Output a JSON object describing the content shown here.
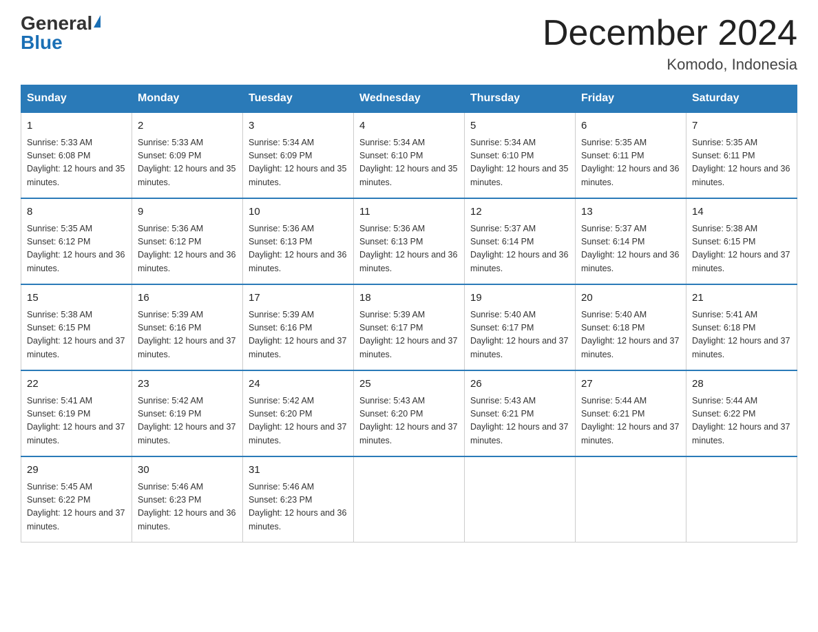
{
  "logo": {
    "general": "General",
    "blue": "Blue"
  },
  "title": "December 2024",
  "location": "Komodo, Indonesia",
  "days_of_week": [
    "Sunday",
    "Monday",
    "Tuesday",
    "Wednesday",
    "Thursday",
    "Friday",
    "Saturday"
  ],
  "weeks": [
    [
      {
        "day": "1",
        "sunrise": "5:33 AM",
        "sunset": "6:08 PM",
        "daylight": "12 hours and 35 minutes."
      },
      {
        "day": "2",
        "sunrise": "5:33 AM",
        "sunset": "6:09 PM",
        "daylight": "12 hours and 35 minutes."
      },
      {
        "day": "3",
        "sunrise": "5:34 AM",
        "sunset": "6:09 PM",
        "daylight": "12 hours and 35 minutes."
      },
      {
        "day": "4",
        "sunrise": "5:34 AM",
        "sunset": "6:10 PM",
        "daylight": "12 hours and 35 minutes."
      },
      {
        "day": "5",
        "sunrise": "5:34 AM",
        "sunset": "6:10 PM",
        "daylight": "12 hours and 35 minutes."
      },
      {
        "day": "6",
        "sunrise": "5:35 AM",
        "sunset": "6:11 PM",
        "daylight": "12 hours and 36 minutes."
      },
      {
        "day": "7",
        "sunrise": "5:35 AM",
        "sunset": "6:11 PM",
        "daylight": "12 hours and 36 minutes."
      }
    ],
    [
      {
        "day": "8",
        "sunrise": "5:35 AM",
        "sunset": "6:12 PM",
        "daylight": "12 hours and 36 minutes."
      },
      {
        "day": "9",
        "sunrise": "5:36 AM",
        "sunset": "6:12 PM",
        "daylight": "12 hours and 36 minutes."
      },
      {
        "day": "10",
        "sunrise": "5:36 AM",
        "sunset": "6:13 PM",
        "daylight": "12 hours and 36 minutes."
      },
      {
        "day": "11",
        "sunrise": "5:36 AM",
        "sunset": "6:13 PM",
        "daylight": "12 hours and 36 minutes."
      },
      {
        "day": "12",
        "sunrise": "5:37 AM",
        "sunset": "6:14 PM",
        "daylight": "12 hours and 36 minutes."
      },
      {
        "day": "13",
        "sunrise": "5:37 AM",
        "sunset": "6:14 PM",
        "daylight": "12 hours and 36 minutes."
      },
      {
        "day": "14",
        "sunrise": "5:38 AM",
        "sunset": "6:15 PM",
        "daylight": "12 hours and 37 minutes."
      }
    ],
    [
      {
        "day": "15",
        "sunrise": "5:38 AM",
        "sunset": "6:15 PM",
        "daylight": "12 hours and 37 minutes."
      },
      {
        "day": "16",
        "sunrise": "5:39 AM",
        "sunset": "6:16 PM",
        "daylight": "12 hours and 37 minutes."
      },
      {
        "day": "17",
        "sunrise": "5:39 AM",
        "sunset": "6:16 PM",
        "daylight": "12 hours and 37 minutes."
      },
      {
        "day": "18",
        "sunrise": "5:39 AM",
        "sunset": "6:17 PM",
        "daylight": "12 hours and 37 minutes."
      },
      {
        "day": "19",
        "sunrise": "5:40 AM",
        "sunset": "6:17 PM",
        "daylight": "12 hours and 37 minutes."
      },
      {
        "day": "20",
        "sunrise": "5:40 AM",
        "sunset": "6:18 PM",
        "daylight": "12 hours and 37 minutes."
      },
      {
        "day": "21",
        "sunrise": "5:41 AM",
        "sunset": "6:18 PM",
        "daylight": "12 hours and 37 minutes."
      }
    ],
    [
      {
        "day": "22",
        "sunrise": "5:41 AM",
        "sunset": "6:19 PM",
        "daylight": "12 hours and 37 minutes."
      },
      {
        "day": "23",
        "sunrise": "5:42 AM",
        "sunset": "6:19 PM",
        "daylight": "12 hours and 37 minutes."
      },
      {
        "day": "24",
        "sunrise": "5:42 AM",
        "sunset": "6:20 PM",
        "daylight": "12 hours and 37 minutes."
      },
      {
        "day": "25",
        "sunrise": "5:43 AM",
        "sunset": "6:20 PM",
        "daylight": "12 hours and 37 minutes."
      },
      {
        "day": "26",
        "sunrise": "5:43 AM",
        "sunset": "6:21 PM",
        "daylight": "12 hours and 37 minutes."
      },
      {
        "day": "27",
        "sunrise": "5:44 AM",
        "sunset": "6:21 PM",
        "daylight": "12 hours and 37 minutes."
      },
      {
        "day": "28",
        "sunrise": "5:44 AM",
        "sunset": "6:22 PM",
        "daylight": "12 hours and 37 minutes."
      }
    ],
    [
      {
        "day": "29",
        "sunrise": "5:45 AM",
        "sunset": "6:22 PM",
        "daylight": "12 hours and 37 minutes."
      },
      {
        "day": "30",
        "sunrise": "5:46 AM",
        "sunset": "6:23 PM",
        "daylight": "12 hours and 36 minutes."
      },
      {
        "day": "31",
        "sunrise": "5:46 AM",
        "sunset": "6:23 PM",
        "daylight": "12 hours and 36 minutes."
      },
      null,
      null,
      null,
      null
    ]
  ]
}
